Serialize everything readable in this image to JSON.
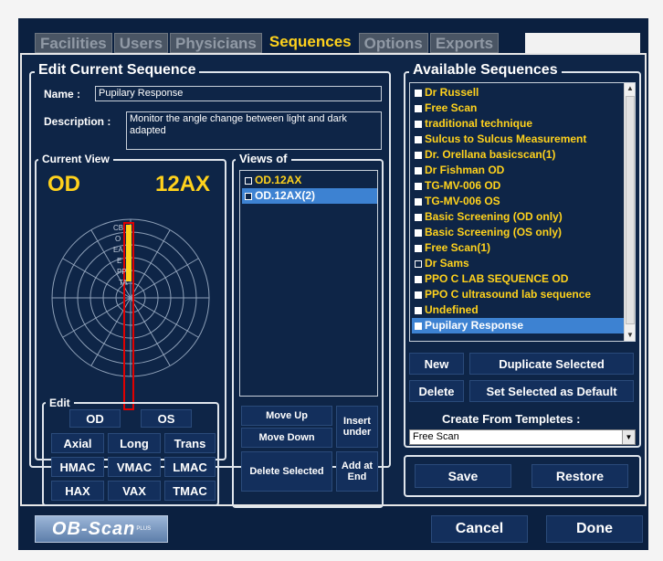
{
  "tabs": [
    {
      "label": "Facilities",
      "active": false
    },
    {
      "label": "Users",
      "active": false
    },
    {
      "label": "Physicians",
      "active": false
    },
    {
      "label": "Sequences",
      "active": true
    },
    {
      "label": "Options",
      "active": false
    },
    {
      "label": "Exports",
      "active": false
    }
  ],
  "edit_sequence": {
    "title": "Edit Current Sequence",
    "name_label": "Name :",
    "name_value": "Pupilary Response",
    "description_label": "Description :",
    "description_value": "Monitor the angle change between light and dark adapted"
  },
  "current_view": {
    "title": "Current View",
    "eye": "OD",
    "code": "12AX",
    "polar_labels": [
      "CB",
      "O",
      "EA",
      "E",
      "PP",
      "TA"
    ],
    "accent_color": "#ffd21c",
    "outline_color": "#e00000"
  },
  "edit": {
    "title": "Edit",
    "eye_buttons": [
      "OD",
      "OS"
    ],
    "grid_buttons": [
      "Axial",
      "Long",
      "Trans",
      "HMAC",
      "VMAC",
      "LMAC",
      "HAX",
      "VAX",
      "TMAC"
    ]
  },
  "views_of": {
    "title": "Views of",
    "items": [
      {
        "label": "OD.12AX",
        "checked": true,
        "selected": false
      },
      {
        "label": "OD.12AX(2)",
        "checked": true,
        "selected": true
      }
    ],
    "buttons": {
      "move_up": "Move Up",
      "insert_under": "Insert under",
      "move_down": "Move Down",
      "delete_selected": "Delete Selected",
      "add_at_end": "Add at End"
    }
  },
  "available": {
    "title": "Available Sequences",
    "items": [
      {
        "label": "Dr Russell",
        "checked": false,
        "selected": false
      },
      {
        "label": "Free Scan",
        "checked": false,
        "selected": false
      },
      {
        "label": "traditional technique",
        "checked": false,
        "selected": false
      },
      {
        "label": "Sulcus to Sulcus Measurement",
        "checked": false,
        "selected": false
      },
      {
        "label": "Dr. Orellana basicscan(1)",
        "checked": false,
        "selected": false
      },
      {
        "label": "Dr Fishman OD",
        "checked": false,
        "selected": false
      },
      {
        "label": "TG-MV-006 OD",
        "checked": false,
        "selected": false
      },
      {
        "label": "TG-MV-006 OS",
        "checked": false,
        "selected": false
      },
      {
        "label": "Basic Screening (OD only)",
        "checked": false,
        "selected": false
      },
      {
        "label": "Basic Screening (OS only)",
        "checked": false,
        "selected": false
      },
      {
        "label": "Free Scan(1)",
        "checked": false,
        "selected": false
      },
      {
        "label": "Dr Sams",
        "checked": true,
        "selected": false
      },
      {
        "label": "PPO C LAB SEQUENCE  OD",
        "checked": false,
        "selected": false
      },
      {
        "label": "PPO C ultrasound lab sequence",
        "checked": false,
        "selected": false
      },
      {
        "label": "Undefined",
        "checked": false,
        "selected": false
      },
      {
        "label": "Pupilary Response",
        "checked": false,
        "selected": true
      }
    ],
    "new_label": "New",
    "duplicate_label": "Duplicate Selected",
    "delete_label": "Delete",
    "set_default_label": "Set Selected as Default",
    "templates_label": "Create From Templetes :",
    "template_value": "Free Scan"
  },
  "save_label": "Save",
  "restore_label": "Restore",
  "cancel_label": "Cancel",
  "done_label": "Done",
  "logo_text": "OB-Scan",
  "logo_sup": "PLUS"
}
